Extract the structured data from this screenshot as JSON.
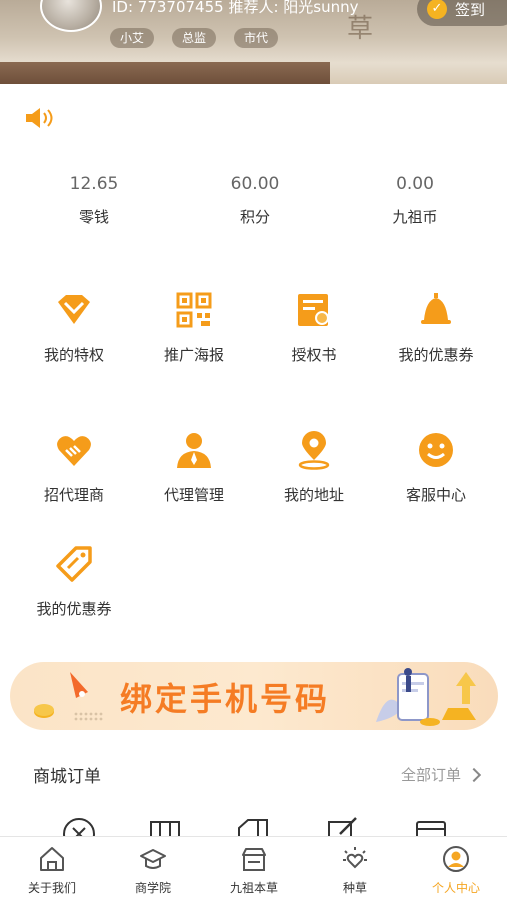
{
  "header": {
    "id_line": "ID: 773707455  推荐人: 阳光sunny",
    "tags": [
      "小艾",
      "总监",
      "市代"
    ],
    "signin_label": "签到"
  },
  "stats": [
    {
      "value": "12.65",
      "label": "零钱"
    },
    {
      "value": "60.00",
      "label": "积分"
    },
    {
      "value": "0.00",
      "label": "九祖币"
    }
  ],
  "grid": [
    {
      "label": "我的特权",
      "icon": "diamond-icon"
    },
    {
      "label": "推广海报",
      "icon": "qr-code-icon"
    },
    {
      "label": "授权书",
      "icon": "certificate-icon"
    },
    {
      "label": "我的优惠券",
      "icon": "bell-icon"
    },
    {
      "label": "招代理商",
      "icon": "handshake-icon"
    },
    {
      "label": "代理管理",
      "icon": "agent-icon"
    },
    {
      "label": "我的地址",
      "icon": "location-pin-icon"
    },
    {
      "label": "客服中心",
      "icon": "smile-icon"
    },
    {
      "label": "我的优惠券",
      "icon": "coupon-tag-icon"
    }
  ],
  "banner": {
    "text": "绑定手机号码"
  },
  "orders": {
    "title": "商城订单",
    "all_label": "全部订单"
  },
  "tabs": [
    {
      "label": "关于我们",
      "icon": "home-icon"
    },
    {
      "label": "商学院",
      "icon": "graduation-cap-icon"
    },
    {
      "label": "九祖本草",
      "icon": "store-icon"
    },
    {
      "label": "种草",
      "icon": "sun-heart-icon"
    },
    {
      "label": "个人中心",
      "icon": "person-icon"
    }
  ],
  "colors": {
    "accent": "#f5a623",
    "icon_orange": "#f59c1a",
    "banner_text": "#f57c24"
  }
}
